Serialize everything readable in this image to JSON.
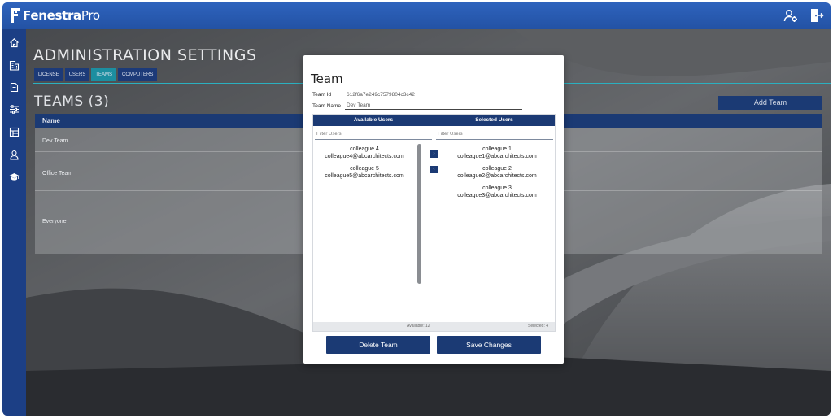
{
  "app": {
    "brand_bold": "Fenestra",
    "brand_light": "Pro",
    "colors": {
      "topbar": "#2a5bb0",
      "sidebar": "#1c3f85",
      "navy": "#1b3a74",
      "teal": "#1c8ea0"
    }
  },
  "topbar": {
    "icons": [
      "user-settings-icon",
      "logout-icon"
    ]
  },
  "sidebar": {
    "icons": [
      "home-icon",
      "building-icon",
      "document-icon",
      "sliders-icon",
      "dashboard-icon",
      "person-icon",
      "graduation-cap-icon"
    ]
  },
  "admin": {
    "title": "ADMINISTRATION SETTINGS",
    "tabs": [
      {
        "label": "LICENSE",
        "active": false
      },
      {
        "label": "USERS",
        "active": false
      },
      {
        "label": "TEAMS",
        "active": true
      },
      {
        "label": "COMPUTERS",
        "active": false
      }
    ],
    "teams_title": "TEAMS (3)",
    "add_team_label": "Add Team",
    "table": {
      "header": "Name",
      "rows": [
        "Dev Team",
        "Office Team",
        "Everyone"
      ]
    }
  },
  "modal": {
    "title": "Team",
    "team_id_label": "Team Id",
    "team_id_value": "612f6a7e249c7579804c3c42",
    "team_name_label": "Team Name",
    "team_name_value": "Dev Team",
    "available_header": "Available Users",
    "selected_header": "Selected Users",
    "filter_placeholder": "Filter Users",
    "available_users": [
      {
        "name": "colleague 4",
        "email": "colleague4@abcarchitects.com"
      },
      {
        "name": "colleague 5",
        "email": "colleague5@abcarchitects.com"
      }
    ],
    "selected_users": [
      {
        "name": "colleague 1",
        "email": "colleague1@abcarchitects.com"
      },
      {
        "name": "colleague 2",
        "email": "colleague2@abcarchitects.com"
      },
      {
        "name": "colleague 3",
        "email": "colleague3@abcarchitects.com"
      }
    ],
    "move_right_glyph": "›",
    "move_left_glyph": "‹",
    "available_count_label": "Available: 12",
    "selected_count_label": "Selected: 4",
    "delete_label": "Delete Team",
    "save_label": "Save Changes"
  }
}
